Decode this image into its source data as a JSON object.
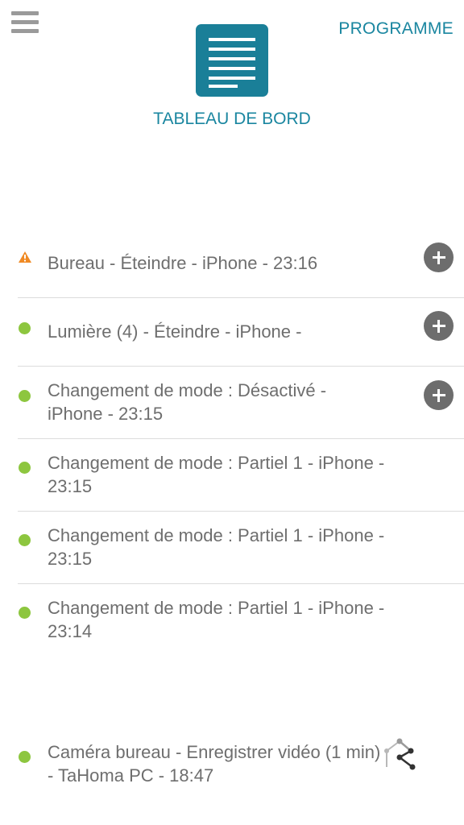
{
  "header": {
    "programme_label": "PROGRAMME",
    "dashboard_label": "TABLEAU DE BORD",
    "menu_icon": "hamburger-menu-icon",
    "dashboard_icon": "document-list-icon"
  },
  "colors": {
    "accent": "#1a86a0",
    "tile": "#1a7f98",
    "success": "#8dc63f",
    "warning": "#f08a24",
    "text": "#6e6e6e",
    "divider": "#dcdcdc"
  },
  "events": [
    {
      "status": "warning",
      "text": "Bureau - Éteindre - iPhone - 23:16",
      "has_add": true
    },
    {
      "status": "ok",
      "text": "Lumière (4) - Éteindre - iPhone -",
      "has_add": true
    },
    {
      "status": "ok",
      "text": "Changement de mode : Désactivé - iPhone - 23:15",
      "has_add": true
    },
    {
      "status": "ok",
      "text": "Changement de mode : Partiel 1 - iPhone - 23:15",
      "has_add": false
    },
    {
      "status": "ok",
      "text": "Changement de mode : Partiel 1 - iPhone - 23:15",
      "has_add": false
    },
    {
      "status": "ok",
      "text": "Changement de mode : Partiel 1 - iPhone - 23:14",
      "has_add": false
    }
  ],
  "camera_event": {
    "status": "ok",
    "text": "Caméra bureau - Enregistrer vidéo (1 min) - TaHoma PC - 18:47",
    "icon": "tahoma-network-icon"
  }
}
